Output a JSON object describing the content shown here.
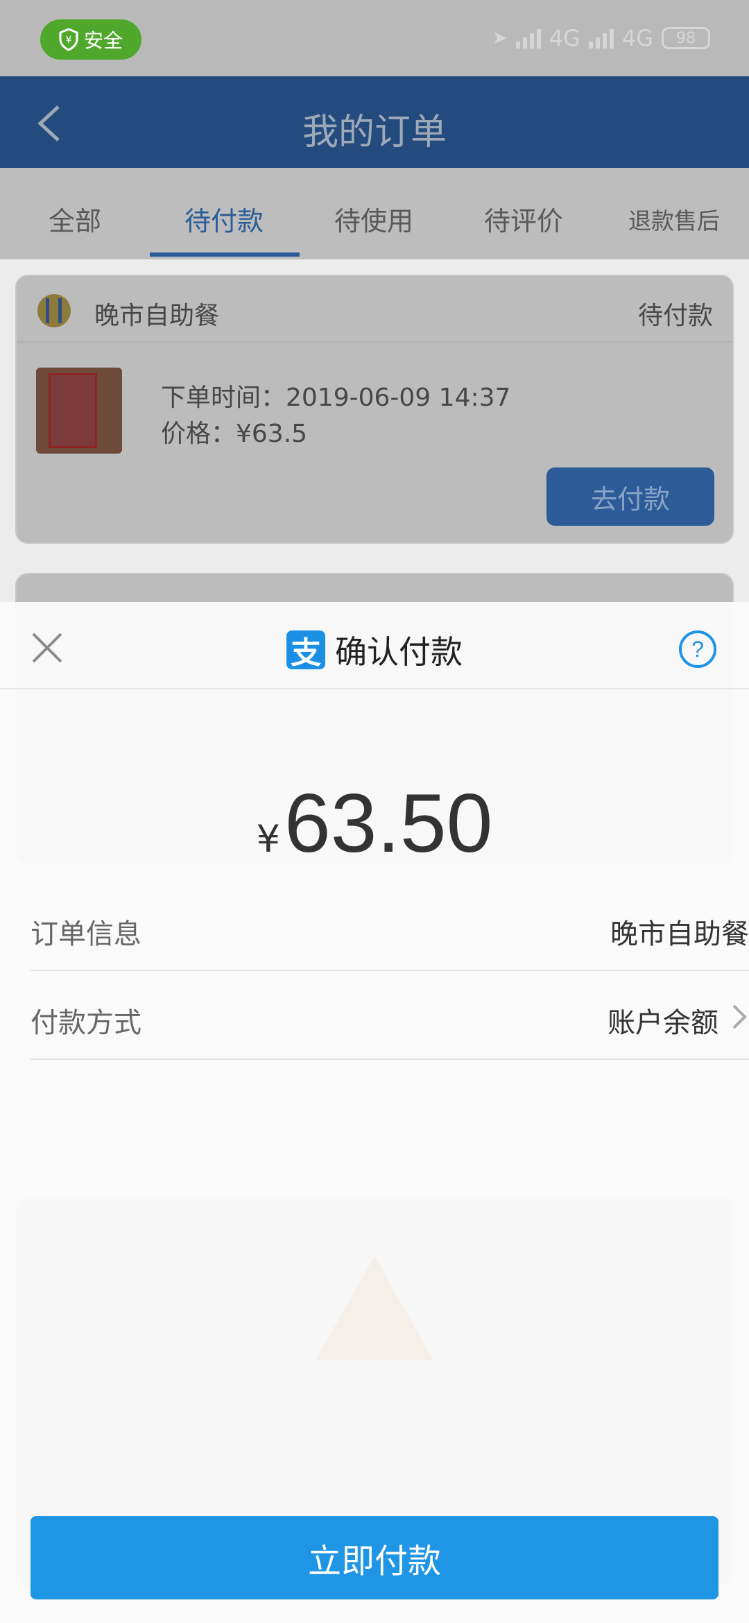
{
  "status_bar": {
    "safe_label": "安全",
    "network_1": "4G",
    "network_2": "4G",
    "battery": "98"
  },
  "header": {
    "title": "我的订单"
  },
  "tabs": [
    {
      "label": "全部"
    },
    {
      "label": "待付款"
    },
    {
      "label": "待使用"
    },
    {
      "label": "待评价"
    },
    {
      "label": "退款售后"
    }
  ],
  "orders": [
    {
      "shop_name": "晚市自助餐",
      "status": "待付款",
      "order_time": "下单时间：2019-06-09 14:37",
      "price": "价格：¥63.5",
      "button": "去付款"
    }
  ],
  "payment_sheet": {
    "title": "确认付款",
    "logo_char": "支",
    "currency": "¥",
    "amount": "63.50",
    "order_info_label": "订单信息",
    "order_info_value": "晚市自助餐",
    "method_label": "付款方式",
    "method_value": "账户余额",
    "confirm_button": "立即付款"
  },
  "colors": {
    "alipay_blue": "#1f95e6",
    "safe_green": "#4fa82c",
    "header_blue_dimmed": "#234b7e"
  }
}
